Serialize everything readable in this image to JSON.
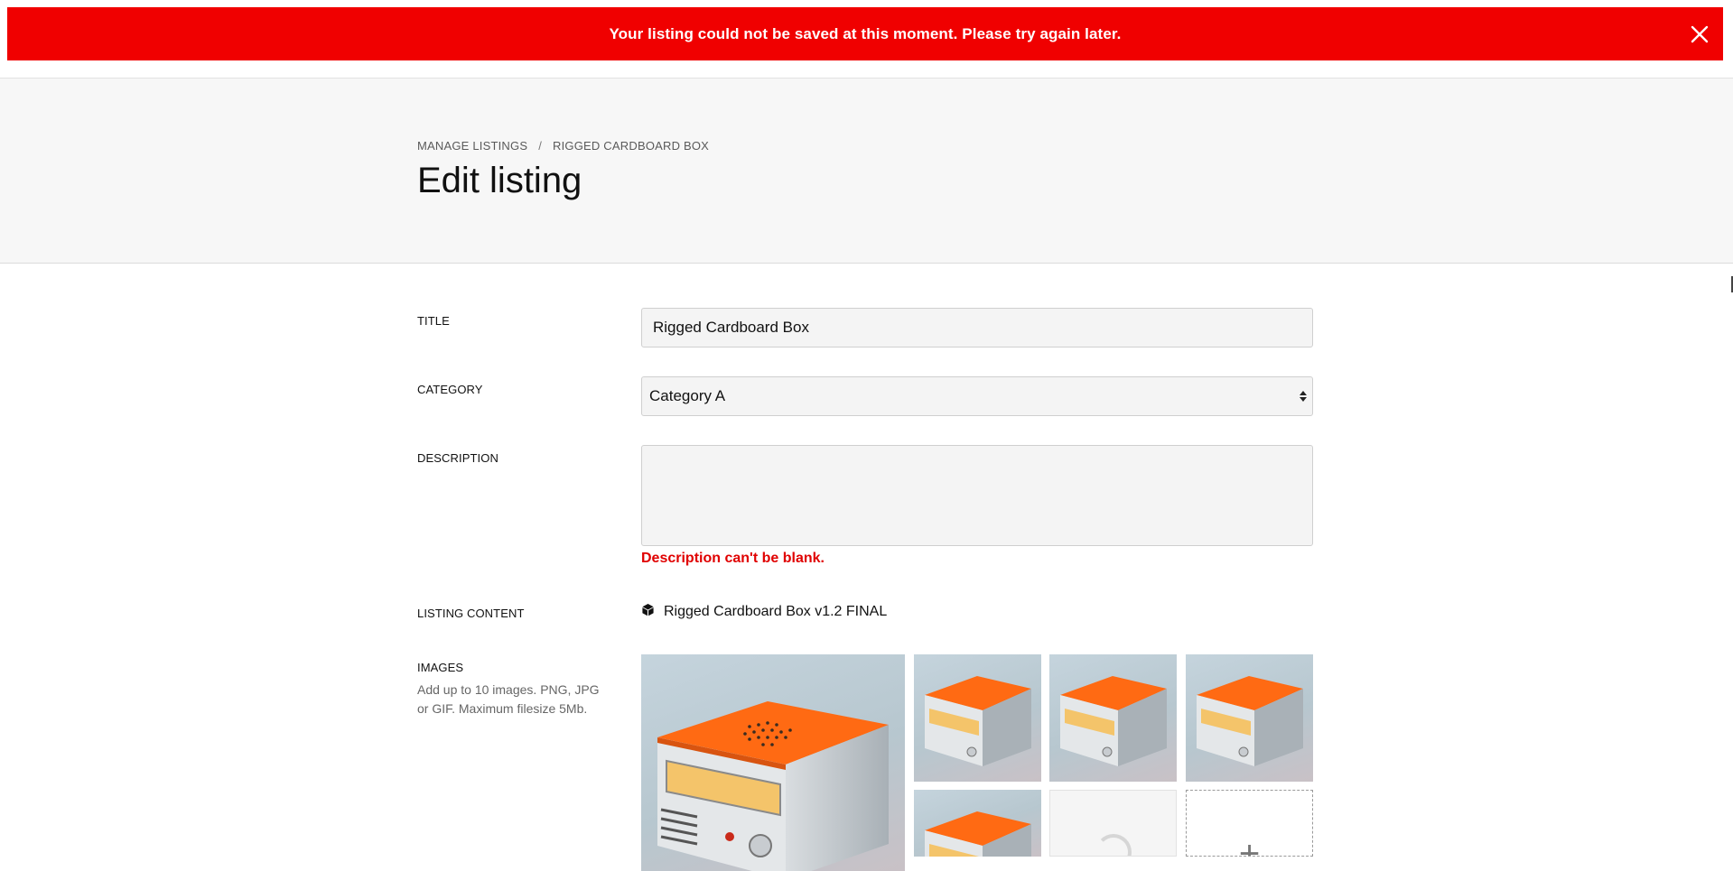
{
  "alert": {
    "message": "Your listing could not be saved at this moment. Please try again later.",
    "close_icon": "close-icon",
    "color": "#f00000"
  },
  "breadcrumb": {
    "items": [
      "MANAGE LISTINGS",
      "RIGGED CARDBOARD BOX"
    ],
    "separator": "/"
  },
  "page": {
    "title": "Edit listing"
  },
  "form": {
    "title_label": "TITLE",
    "title_value": "Rigged Cardboard Box",
    "category_label": "CATEGORY",
    "category_value": "Category A",
    "description_label": "DESCRIPTION",
    "description_value": "",
    "description_error": "Description can't be blank.",
    "listing_content_label": "LISTING CONTENT",
    "listing_content_icon": "cube-icon",
    "listing_content_value": "Rigged Cardboard Box v1.2 FINAL",
    "images_label": "IMAGES",
    "images_help": "Add up to 10 images. PNG, JPG or GIF. Maximum filesize 5Mb.",
    "add_image_symbol": "+"
  },
  "colors": {
    "error": "#e00000",
    "header_band": "#f7f7f7",
    "radio_body": "#ff6a13"
  }
}
